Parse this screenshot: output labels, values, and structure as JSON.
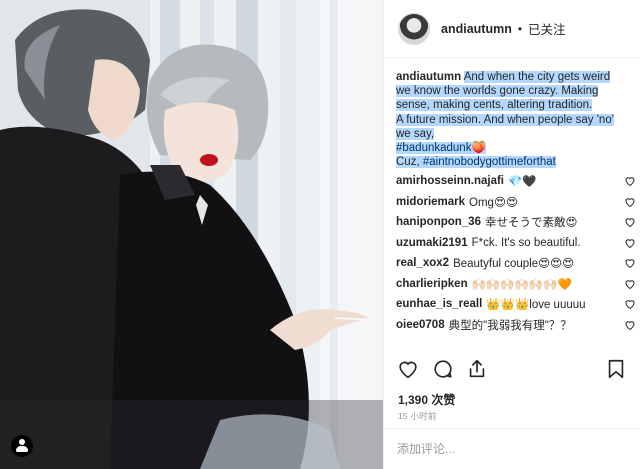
{
  "post": {
    "username": "andiautumn",
    "follow_status": "已关注",
    "separator": "•"
  },
  "caption": {
    "username": "andiautumn",
    "line1_plain": "And when the city gets weird",
    "lines_highlighted": [
      "we know the worlds gone crazy. Making",
      "sense, making cents, altering tradition.",
      "A future mission. And when people say 'no'",
      "we say,"
    ],
    "hashtag1": "#badunkadunk",
    "hashtag1_emoji": "🍑",
    "line_last_prefix": "Cuz, ",
    "hashtag2": "#aintnobodygottimeforthat"
  },
  "comments": [
    {
      "user": "amirhosseinn.najafi",
      "text": "💎🖤"
    },
    {
      "user": "midoriemark",
      "text": "Omg😍😍"
    },
    {
      "user": "haniponpon_36",
      "text": "幸せそうで素敵😍"
    },
    {
      "user": "uzumaki2191",
      "text": "F*ck. It's so beautiful."
    },
    {
      "user": "real_xox2",
      "text": "Beautyful couple😍😍😍"
    },
    {
      "user": "charlieripken",
      "text": "🙌🏻🙌🏻🙌🏻🙌🏻🙌🏻🙌🏻🧡"
    },
    {
      "user": "eunhae_is_reall",
      "text": "👑👑👑love uuuuu"
    },
    {
      "user": "oiee0708",
      "text": "典型的\"我弱我有理\"？？"
    }
  ],
  "actions": {
    "like_icon": "heart-icon",
    "comment_icon": "comment-icon",
    "share_icon": "share-icon",
    "save_icon": "bookmark-icon"
  },
  "likes": "1,390 次赞",
  "timestamp": "15 小时前",
  "add_comment": {
    "placeholder": "添加评论..."
  },
  "colors": {
    "highlight": "#b3d7fe",
    "link": "#003569",
    "text": "#262626",
    "muted": "#999999"
  }
}
